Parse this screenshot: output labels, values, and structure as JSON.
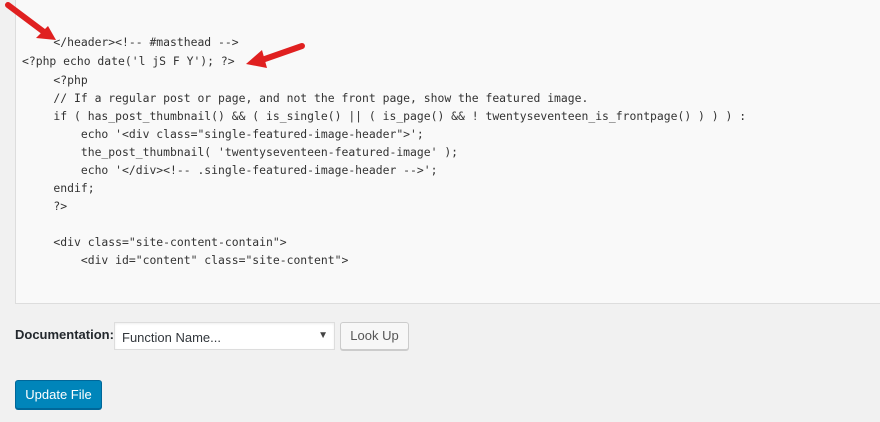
{
  "editor": {
    "lines": [
      "    </header><!-- #masthead -->",
      "<?php echo date('l jS F Y'); ?>",
      "    <?php",
      "    // If a regular post or page, and not the front page, show the featured image.",
      "    if ( has_post_thumbnail() && ( is_single() || ( is_page() && ! twentyseventeen_is_frontpage() ) ) ) :",
      "        echo '<div class=\"single-featured-image-header\">';",
      "        the_post_thumbnail( 'twentyseventeen-featured-image' );",
      "        echo '</div><!-- .single-featured-image-header -->';",
      "    endif;",
      "    ?>",
      "",
      "    <div class=\"site-content-contain\">",
      "        <div id=\"content\" class=\"site-content\">"
    ]
  },
  "annotations": {
    "arrow_color": "#e02020"
  },
  "documentation": {
    "label": "Documentation:",
    "select_value": "Function Name...",
    "caret_icon": "▼",
    "lookup_label": "Look Up"
  },
  "actions": {
    "update_label": "Update File"
  },
  "colors": {
    "primary_button": "#0085ba",
    "background": "#f1f1f1",
    "editor_background": "#f9f9f9"
  }
}
